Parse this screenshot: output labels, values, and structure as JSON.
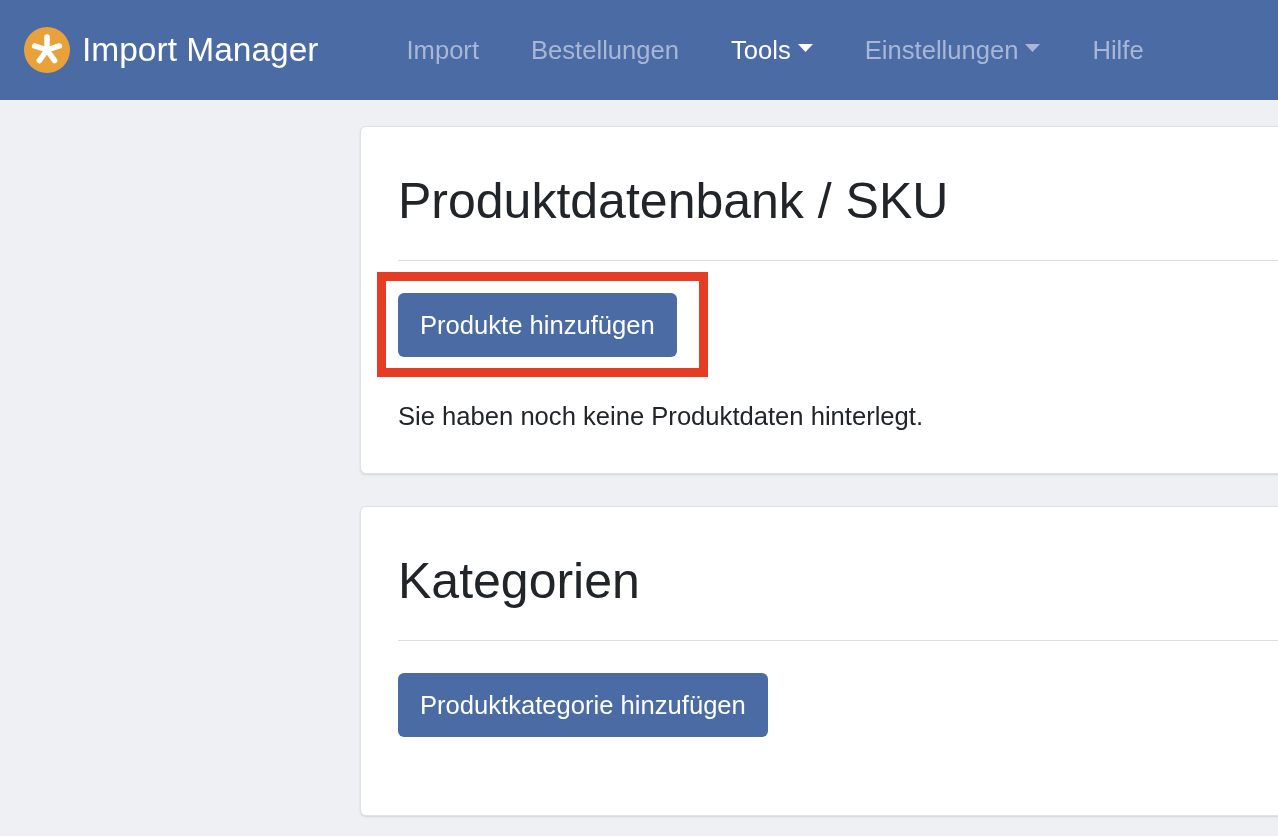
{
  "navbar": {
    "brand": "Import Manager",
    "items": [
      {
        "label": "Import",
        "selected": false,
        "dropdown": false
      },
      {
        "label": "Bestellungen",
        "selected": false,
        "dropdown": false
      },
      {
        "label": "Tools",
        "selected": true,
        "dropdown": true
      },
      {
        "label": "Einstellungen",
        "selected": false,
        "dropdown": true
      },
      {
        "label": "Hilfe",
        "selected": false,
        "dropdown": false
      }
    ]
  },
  "cards": [
    {
      "title": "Produktdatenbank / SKU",
      "button": {
        "label": "Produkte hinzufügen",
        "highlighted": true
      },
      "message": "Sie haben noch keine Produktdaten hinterlegt."
    },
    {
      "title": "Kategorien",
      "button": {
        "label": "Produktkategorie hinzufügen",
        "highlighted": false
      }
    }
  ]
}
